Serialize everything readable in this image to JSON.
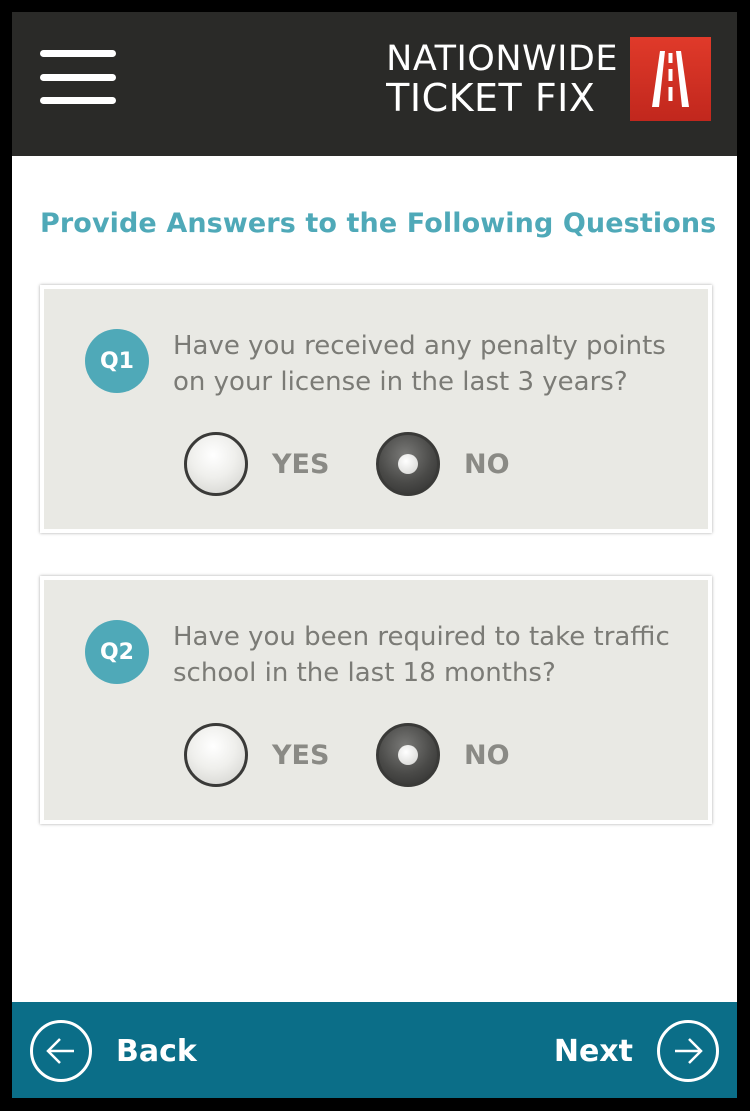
{
  "header": {
    "brand_line1": "NATIONWIDE",
    "brand_line2": "TICKET FIX",
    "menu_icon": "hamburger-menu-icon",
    "logo_icon": "road-logo-icon",
    "background": "#2a2a28",
    "logo_color": "#d1301f"
  },
  "page": {
    "title": "Provide Answers to the Following Questions",
    "accent": "#4fa9b8"
  },
  "questions": [
    {
      "badge": "Q1",
      "text": "Have you received any penalty points on your license in the last 3 years?",
      "options": [
        {
          "label": "YES",
          "selected": false
        },
        {
          "label": "NO",
          "selected": true
        }
      ]
    },
    {
      "badge": "Q2",
      "text": "Have you been required to take traffic school in the last 18 months?",
      "options": [
        {
          "label": "YES",
          "selected": false
        },
        {
          "label": "NO",
          "selected": true
        }
      ]
    }
  ],
  "footer": {
    "back_label": "Back",
    "next_label": "Next",
    "back_icon": "arrow-left-icon",
    "next_icon": "arrow-right-icon",
    "background": "#0b6e88"
  }
}
